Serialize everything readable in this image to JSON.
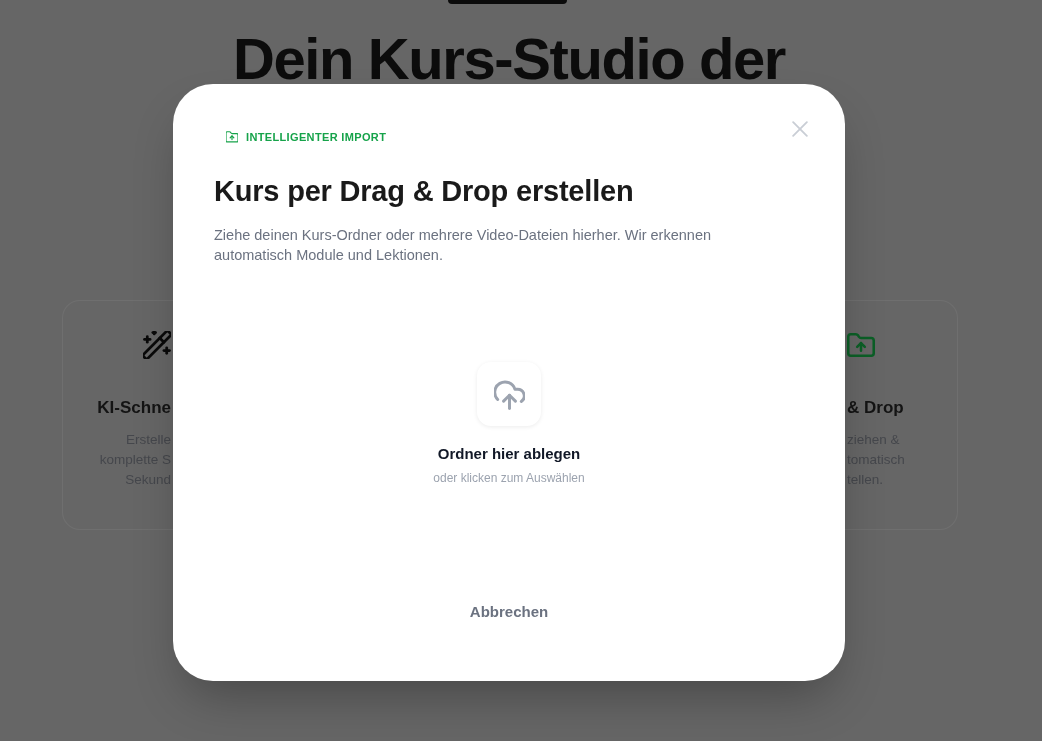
{
  "background": {
    "heading": "Dein Kurs-Studio der",
    "features": [
      {
        "title": "KI-Schne",
        "lines": [
          "Erstelle",
          "komplette S",
          "Sekund"
        ]
      },
      {
        "title": "& Drop",
        "lines": [
          "ziehen &",
          "tomatisch",
          "tellen."
        ]
      }
    ]
  },
  "dialog": {
    "tag": "INTELLIGENTER IMPORT",
    "title": "Kurs per Drag & Drop erstellen",
    "description": "Ziehe deinen Kurs-Ordner oder mehrere Video-Dateien hierher. Wir erkennen automatisch Module und Lektionen.",
    "drop_zone": {
      "title": "Ordner hier ablegen",
      "hint": "oder klicken zum Auswählen"
    },
    "cancel_button": "Abbrechen"
  }
}
